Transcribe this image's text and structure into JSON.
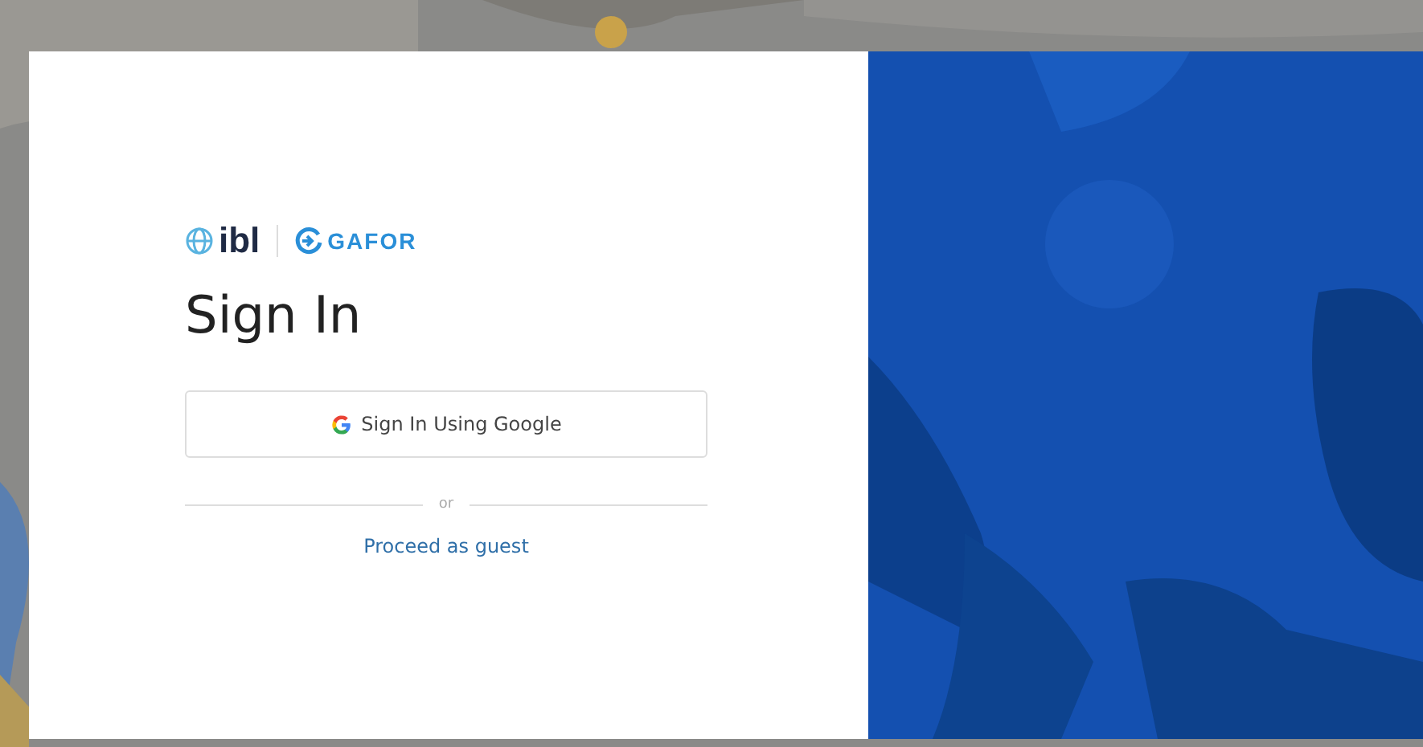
{
  "dialog": {
    "logos": [
      {
        "kind": "globe",
        "text": "ibl"
      },
      {
        "kind": "arrow",
        "text": "GAFOR"
      }
    ],
    "title": "Sign In",
    "google_button": {
      "label": "Sign In Using Google"
    },
    "separator": "or",
    "guest_link": "Proceed as guest"
  }
}
